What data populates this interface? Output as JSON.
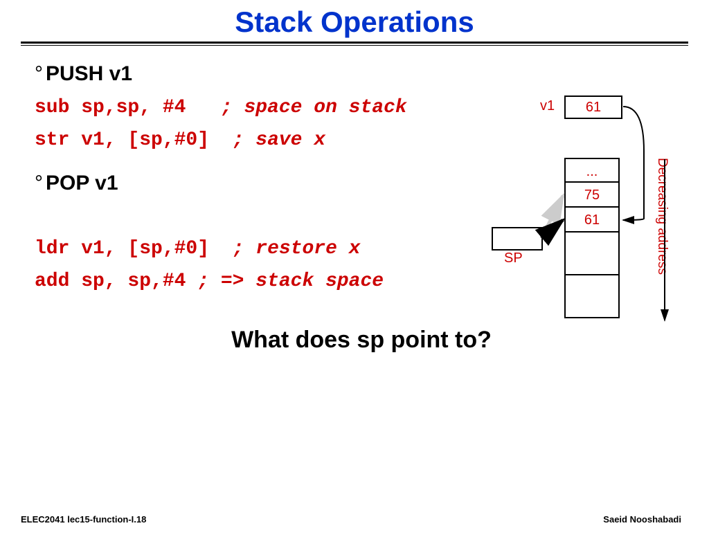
{
  "title": "Stack Operations",
  "push_heading": "PUSH v1",
  "code1_instr": "sub sp,sp, #4   ",
  "code1_comment": "; space on stack",
  "code2_instr": "str v1, [sp,#0]  ",
  "code2_comment": "; save x",
  "pop_heading": "POP v1",
  "code3_instr": "ldr v1, [sp,#0]  ",
  "code3_comment": "; restore x",
  "code4_instr": "add sp, sp,#4 ",
  "code4_comment": "; => stack space",
  "question": "What does sp point to?",
  "footer_left": "ELEC2041  lec15-function-I.18",
  "footer_right": "Saeid Nooshabadi",
  "diagram": {
    "v1_label": "v1",
    "v1_value": "61",
    "sp_label": "SP",
    "stack_top": "...",
    "stack_cell2": "75",
    "stack_cell3": "61",
    "decreasing": "Decreasing address"
  }
}
